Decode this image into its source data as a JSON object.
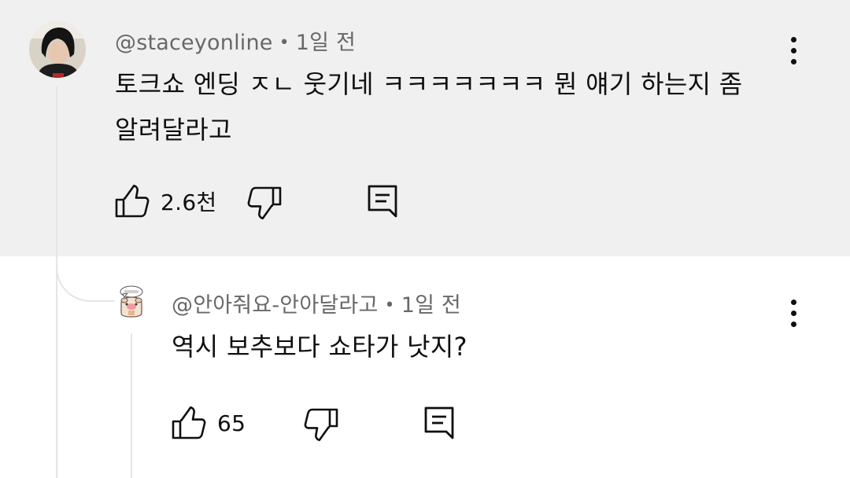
{
  "top_comment": {
    "author": "@staceyonline",
    "separator": "•",
    "time": "1일 전",
    "text_line1": "토크쇼 엔딩 ㅈㄴ 웃기네 ㅋㅋㅋㅋㅋㅋㅋ 뭔 얘기 하는지 좀",
    "text_line2": "알려달라고",
    "likes": "2.6천",
    "icons": [
      "thumbs-up-icon",
      "thumbs-down-icon",
      "reply-icon",
      "more-vert-icon"
    ]
  },
  "reply": {
    "author": "@안아줘요-안아달라고",
    "separator": "•",
    "time": "1일 전",
    "text": "역시 보추보다 쇼타가 낫지?",
    "likes": "65",
    "icons": [
      "thumbs-up-icon",
      "thumbs-down-icon",
      "reply-icon",
      "more-vert-icon"
    ]
  },
  "colors": {
    "highlight_background": "#f0f0f0",
    "text": "#0f0f0f",
    "meta_text": "#686868",
    "thread_line": "#e5e5e5"
  }
}
